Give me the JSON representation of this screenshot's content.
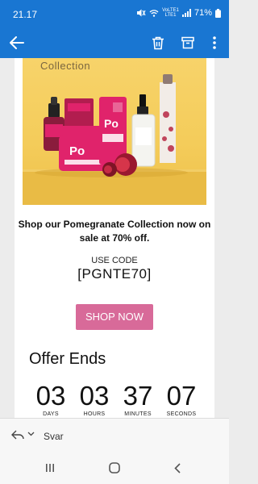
{
  "status": {
    "time": "21.17",
    "network_top": "VoLTE1",
    "network_bottom": "LTE1",
    "battery": "71%"
  },
  "icons": {
    "back": "arrow-left-icon",
    "delete": "trash-icon",
    "archive": "archive-icon",
    "more": "more-vert-icon",
    "reply": "reply-icon",
    "reply_options": "chevron-down-icon",
    "recents": "recents-icon",
    "home": "home-icon",
    "nav_back": "nav-back-icon"
  },
  "email": {
    "hero_caption": "Collection",
    "hero_jar_label": "Po",
    "headline": "Shop our Pomegranate Collection now on sale at 70% off.",
    "code_label": "USE CODE",
    "code": "[PGNTE70]",
    "shop_button": "SHOP NOW",
    "offer_title": "Offer Ends",
    "countdown": [
      {
        "value": "03",
        "label": "DAYS"
      },
      {
        "value": "03",
        "label": "HOURS"
      },
      {
        "value": "37",
        "label": "MINUTES"
      },
      {
        "value": "07",
        "label": "SECONDS"
      }
    ]
  },
  "reply": {
    "label": "Svar"
  },
  "colors": {
    "appbar": "#1976d2",
    "button": "#d86a99",
    "hero_bg": "#f4cc5a",
    "brand_pink": "#e0236b"
  }
}
